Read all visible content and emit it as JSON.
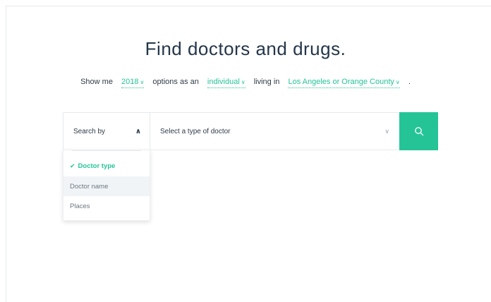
{
  "heading": "Find doctors and drugs.",
  "sentence": {
    "prefix": "Show me",
    "year": "2018",
    "middle1": "options as an",
    "coverage": "individual",
    "middle2": "living in",
    "location": "Los Angeles or Orange County",
    "suffix": "."
  },
  "search": {
    "by_label": "Search by",
    "type_placeholder": "Select a type of doctor",
    "button_icon": "search-icon"
  },
  "dropdown": {
    "items": [
      {
        "label": "Doctor type",
        "selected": true
      },
      {
        "label": "Doctor name",
        "selected": false
      },
      {
        "label": "Places",
        "selected": false
      }
    ]
  },
  "colors": {
    "accent": "#25c497",
    "heading": "#24364a"
  }
}
